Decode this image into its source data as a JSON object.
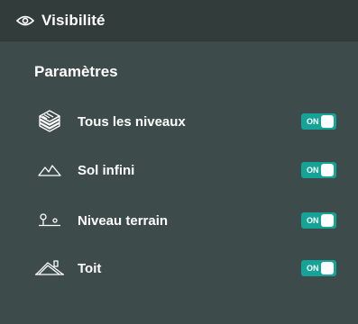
{
  "header": {
    "title": "Visibilité",
    "icon": "eye-icon"
  },
  "section": {
    "title": "Paramètres"
  },
  "items": [
    {
      "label": "Tous les niveaux",
      "icon": "layers-stack-icon",
      "toggle": "ON",
      "on": true
    },
    {
      "label": "Sol infini",
      "icon": "mountains-icon",
      "toggle": "ON",
      "on": true
    },
    {
      "label": "Niveau terrain",
      "icon": "terrain-pins-icon",
      "toggle": "ON",
      "on": true
    },
    {
      "label": "Toit",
      "icon": "roof-icon",
      "toggle": "ON",
      "on": true
    }
  ],
  "colors": {
    "panel": "#3d4c4a",
    "header": "#323d3b",
    "toggle_on": "#14a396"
  }
}
